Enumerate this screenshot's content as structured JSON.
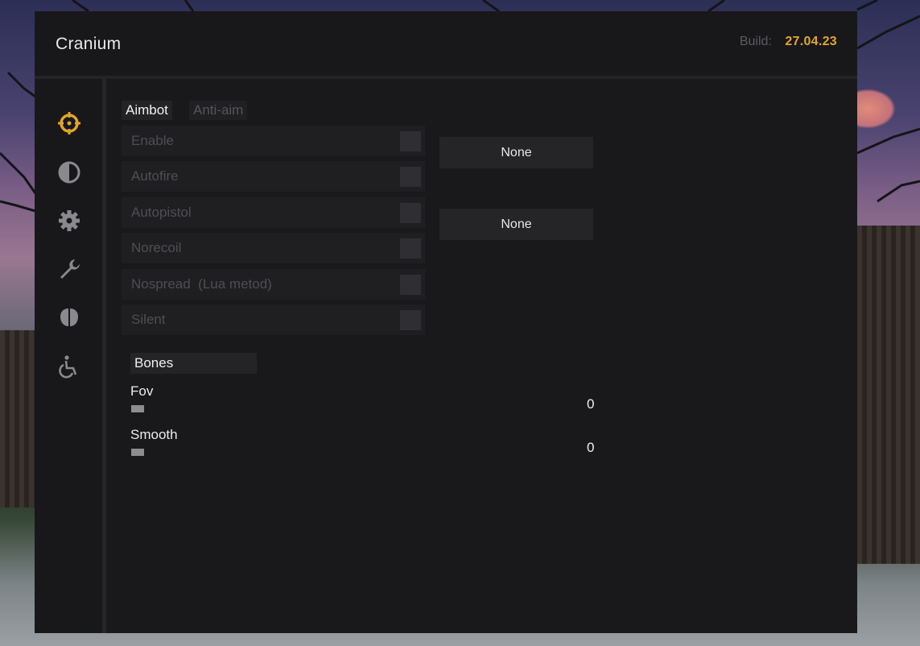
{
  "app": {
    "title": "Cranium",
    "build_label": "Build:",
    "build_value": "27.04.23",
    "accent_color": "#e2a52a"
  },
  "sidebar": {
    "items": [
      {
        "icon": "crosshair-icon",
        "active": true
      },
      {
        "icon": "contrast-icon",
        "active": false
      },
      {
        "icon": "gear-icon",
        "active": false
      },
      {
        "icon": "wrench-icon",
        "active": false
      },
      {
        "icon": "brain-icon",
        "active": false
      },
      {
        "icon": "wheelchair-icon",
        "active": false
      }
    ]
  },
  "tabs": [
    {
      "label": "Aimbot",
      "active": true
    },
    {
      "label": "Anti-aim",
      "active": false
    }
  ],
  "options": [
    {
      "label": "Enable",
      "checked": false
    },
    {
      "label": "Autofire",
      "checked": false
    },
    {
      "label": "Autopistol",
      "checked": false
    },
    {
      "label": "Norecoil",
      "checked": false
    },
    {
      "label": "Nospread  (Lua metod)",
      "checked": false
    },
    {
      "label": "Silent",
      "checked": false
    }
  ],
  "keybinds": {
    "enable": "None",
    "autopistol": "None"
  },
  "bones": {
    "label": "Bones"
  },
  "sliders": [
    {
      "label": "Fov",
      "value": "0"
    },
    {
      "label": "Smooth",
      "value": "0"
    }
  ]
}
